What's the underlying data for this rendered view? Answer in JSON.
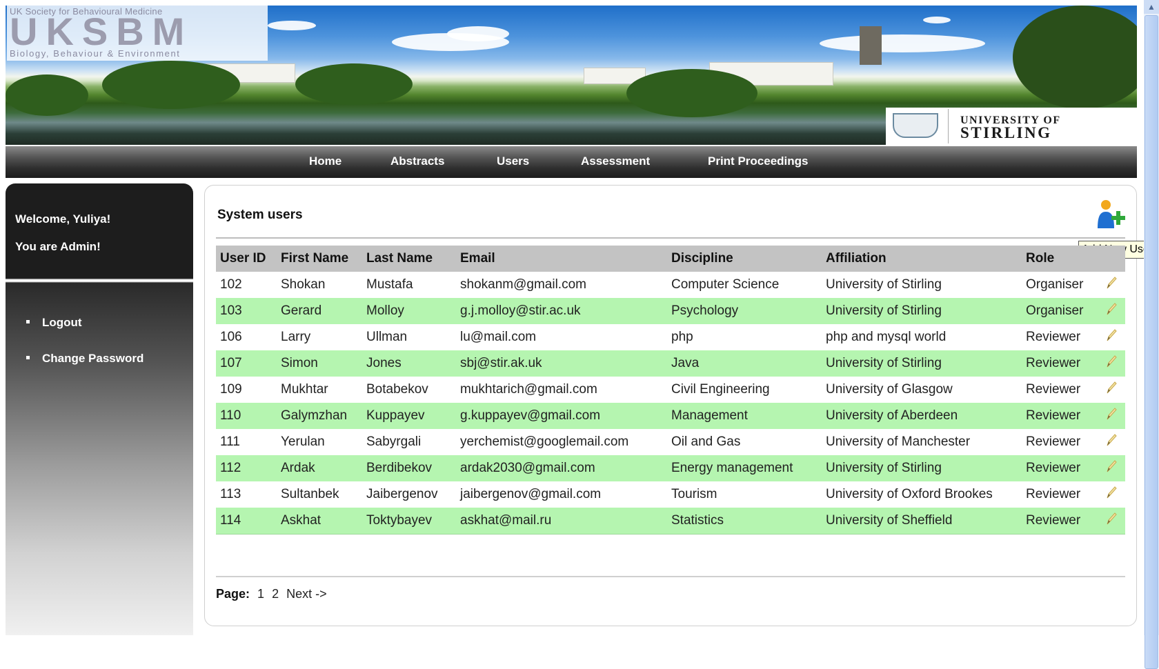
{
  "header": {
    "logo_top": "UK Society for Behavioural Medicine",
    "logo_main": "UKSBM",
    "logo_sub": "Biology, Behaviour & Environment",
    "partner_line1": "UNIVERSITY OF",
    "partner_line2": "STIRLING"
  },
  "nav": {
    "items": [
      "Home",
      "Abstracts",
      "Users",
      "Assessment",
      "Print Proceedings"
    ]
  },
  "sidebar": {
    "welcome": "Welcome, Yuliya!",
    "role_msg": "You are Admin!",
    "links": [
      "Logout",
      "Change Password"
    ]
  },
  "main": {
    "title": "System users",
    "add_tooltip": "Add New User",
    "columns": [
      "User ID",
      "First Name",
      "Last Name",
      "Email",
      "Discipline",
      "Affiliation",
      "Role"
    ],
    "rows": [
      [
        "102",
        "Shokan",
        "Mustafa",
        "shokanm@gmail.com",
        "Computer Science",
        "University of Stirling",
        "Organiser"
      ],
      [
        "103",
        "Gerard",
        "Molloy",
        "g.j.molloy@stir.ac.uk",
        "Psychology",
        "University of Stirling",
        "Organiser"
      ],
      [
        "106",
        "Larry",
        "Ullman",
        "lu@mail.com",
        "php",
        "php and mysql world",
        "Reviewer"
      ],
      [
        "107",
        "Simon",
        "Jones",
        "sbj@stir.ak.uk",
        "Java",
        "University of Stirling",
        "Reviewer"
      ],
      [
        "109",
        "Mukhtar",
        "Botabekov",
        "mukhtarich@gmail.com",
        "Civil Engineering",
        "University of Glasgow",
        "Reviewer"
      ],
      [
        "110",
        "Galymzhan",
        "Kuppayev",
        "g.kuppayev@gmail.com",
        "Management",
        "University of Aberdeen",
        "Reviewer"
      ],
      [
        "111",
        "Yerulan",
        "Sabyrgali",
        "yerchemist@googlemail.com",
        "Oil and Gas",
        "University of Manchester",
        "Reviewer"
      ],
      [
        "112",
        "Ardak",
        "Berdibekov",
        "ardak2030@gmail.com",
        "Energy management",
        "University of Stirling",
        "Reviewer"
      ],
      [
        "113",
        "Sultanbek",
        "Jaibergenov",
        "jaibergenov@gmail.com",
        "Tourism",
        "University of Oxford Brookes",
        "Reviewer"
      ],
      [
        "114",
        "Askhat",
        "Toktybayev",
        "askhat@mail.ru",
        "Statistics",
        "University of Sheffield",
        "Reviewer"
      ]
    ],
    "pager": {
      "label": "Page:",
      "pages": [
        "1",
        "2"
      ],
      "next": "Next ->"
    }
  },
  "colors": {
    "row_alt": "#b5f5b0",
    "header_row": "#c3c3c3",
    "nav_bg": "#2e2e2e"
  },
  "icons": {
    "add_user": "add-user-icon",
    "edit": "pencil-icon"
  }
}
